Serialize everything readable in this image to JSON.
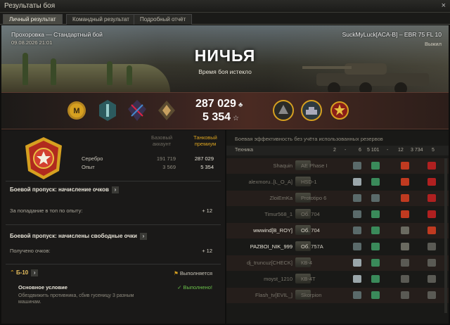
{
  "window": {
    "title": "Результаты боя",
    "close": "×"
  },
  "tabs": [
    {
      "label": "Личный результат",
      "active": true
    },
    {
      "label": "Командный результат",
      "active": false
    },
    {
      "label": "Подробный отчёт",
      "active": false
    }
  ],
  "hero": {
    "map_mode": "Прохоровка — Стандартный бой",
    "date": "09.08.2026 21:01",
    "result": "НИЧЬЯ",
    "reason": "Время боя истекло",
    "player": "SuckMyLuck[ACA-B] – EBR 75 FL 10",
    "status": "Выжил"
  },
  "rewards": {
    "credits": "287 029",
    "experience": "5 354",
    "credits_icon": "credits-icon",
    "exp_icon": "star-icon",
    "medals_left": [
      "mastery-m-icon",
      "blue-medal-icon",
      "crossed-swords-icon",
      "diamond-medal-icon"
    ],
    "medals_right": [
      "wolf-medal-icon",
      "tank-medal-icon",
      "red-star-medal-icon"
    ]
  },
  "earnings": {
    "col_base": "Базовый аккаунт",
    "col_premium": "Танковый премиум",
    "rows": [
      {
        "label": "Серебро",
        "base": "191 719",
        "premium": "287 029"
      },
      {
        "label": "Опыт",
        "base": "3 569",
        "premium": "5 354"
      }
    ]
  },
  "battlepass": [
    {
      "title": "Боевой пропуск: начисление очков",
      "row": "За попадание в топ по опыту:",
      "value": "+ 12"
    },
    {
      "title": "Боевой пропуск: начислены свободные очки",
      "row": "Получено очков:",
      "value": "+ 12"
    }
  ],
  "mission": {
    "title": "Б-10",
    "state": "Выполняется",
    "condition": "Основное условие",
    "done": "✓ Выполнено!",
    "desc": "Обездвижить противника, сбив гусеницу 3 разным машинам."
  },
  "efficiency": {
    "header": "Боевая эффективность без учёта использованных резервов",
    "th_vehicle": "Техника",
    "th_cols": [
      "2",
      "-",
      "6",
      "5 101",
      "-",
      "12",
      "3 734",
      "5"
    ],
    "rows": [
      {
        "name": "Shaquin",
        "vehicle": "AE Phase I",
        "alive": false
      },
      {
        "name": "alexmoru..[L_O_A]",
        "vehicle": "HSD-1",
        "alive": false
      },
      {
        "name": "ZloiEmKa",
        "vehicle": "Prototipo 6",
        "alive": false
      },
      {
        "name": "Timur568_1",
        "vehicle": "Об. 704",
        "alive": false
      },
      {
        "name": "wwwind[B_ROY]",
        "vehicle": "Об. 704",
        "alive": true
      },
      {
        "name": "PAZBOI_NIK_999",
        "vehicle": "Об. 757А",
        "alive": true
      },
      {
        "name": "dj_truncuz[CHECK]",
        "vehicle": "КВ-4",
        "alive": false
      },
      {
        "name": "moyst_1210",
        "vehicle": "КВ-4Т",
        "alive": false
      },
      {
        "name": "Flash_tv[EVIL_]",
        "vehicle": "Skorpion",
        "alive": false
      }
    ]
  },
  "colors": {
    "accent": "#d6a020",
    "red": "#b02a1e",
    "green": "#5aa040"
  }
}
